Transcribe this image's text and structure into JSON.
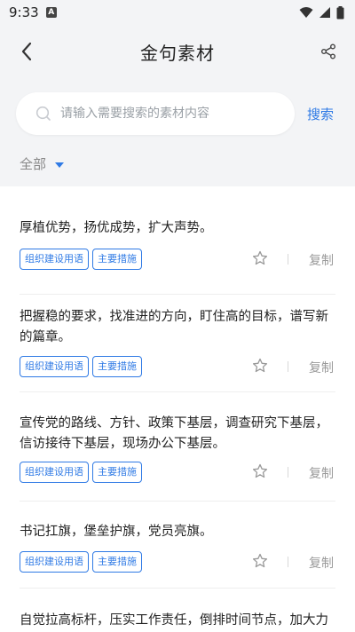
{
  "status_bar": {
    "time": "9:33",
    "badge": "A"
  },
  "header": {
    "title": "金句素材"
  },
  "search": {
    "placeholder": "请输入需要搜索的素材内容",
    "button_label": "搜索"
  },
  "filter": {
    "label": "全部"
  },
  "colors": {
    "accent": "#2f7ae5",
    "background": "#f3f4f6"
  },
  "items": [
    {
      "text": "厚植优势，扬优成势，扩大声势。",
      "tags": [
        "组织建设用语",
        "主要措施"
      ],
      "copy_label": "复制"
    },
    {
      "text": "把握稳的要求，找准进的方向，盯住高的目标，谱写新的篇章。",
      "tags": [
        "组织建设用语",
        "主要措施"
      ],
      "copy_label": "复制"
    },
    {
      "text": "宣传党的路线、方针、政策下基层，调查研究下基层，信访接待下基层，现场办公下基层。",
      "tags": [
        "组织建设用语",
        "主要措施"
      ],
      "copy_label": "复制"
    },
    {
      "text": "书记扛旗，堡垒护旗，党员亮旗。",
      "tags": [
        "组织建设用语",
        "主要措施"
      ],
      "copy_label": "复制"
    },
    {
      "text": "自觉拉高标杆，压实工作责任，倒排时间节点，加大力",
      "tags": [],
      "copy_label": ""
    }
  ]
}
